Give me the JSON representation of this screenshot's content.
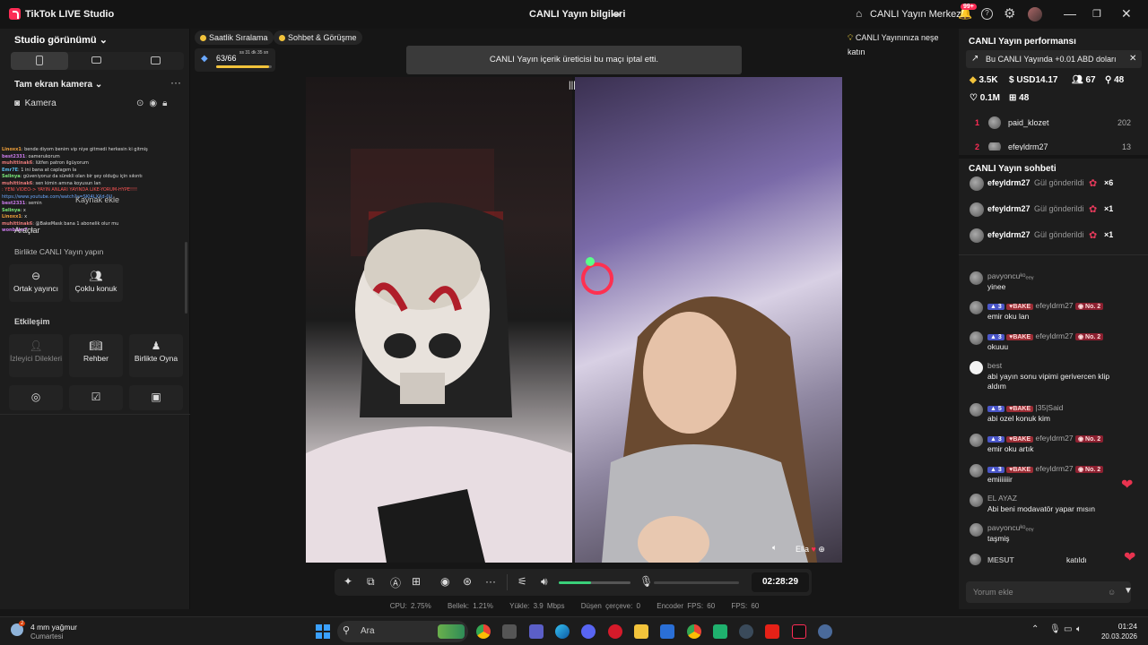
{
  "titlebar": {
    "app_name": "TikTok LIVE Studio",
    "center_title": "CANLI Yayın bilgileri",
    "home_label": "CANLI Yayın Merkezi",
    "notif_badge": "99+"
  },
  "left": {
    "studio_view": "Studio görünümü",
    "camera_section": "Tam ekran kamera",
    "camera_source": "Kamera",
    "ghost_add_source": "Kaynak ekle",
    "ghost_tools": "Araçlar",
    "ghost_together": "Birlikte CANLI Yayın yapın",
    "cohost_cards": [
      {
        "label": "Ortak yayıncı",
        "icon": "link-icon"
      },
      {
        "label": "Çoklu konuk",
        "icon": "users-icon"
      }
    ],
    "interaction_title": "Etkileşim",
    "interaction_cards": [
      {
        "label": "İzleyici Dilekleri",
        "icon": "user-wish-icon"
      },
      {
        "label": "Rehber",
        "icon": "guide-icon"
      },
      {
        "label": "Birlikte Oyna",
        "icon": "play-together-icon"
      }
    ],
    "chat_overlay": [
      {
        "u": "Linoxx1",
        "t": ": bende diyom benim vip niye gitmedi herkesin ki gitmiş",
        "c": "#f0a03a"
      },
      {
        "u": "best2331",
        "t": ": oamerukorum",
        "c": "#c87ae8"
      },
      {
        "u": "muhittinak6",
        "t": ": lütfen patron ilgüyorum",
        "c": "#e87a7a"
      },
      {
        "u": "Emr7E",
        "t": ": 1 ini bana at caplagım la",
        "c": "#58b8e8"
      },
      {
        "u": "Selinya",
        "t": ": güveniyoruz da sürekli olan bir şey olduğu için sıkıntı",
        "c": "#7ae87a"
      },
      {
        "u": "muhittinak6",
        "t": ": sen kimin amına koyusun lan",
        "c": "#e87a7a"
      },
      {
        "u": "",
        "t": ": YENİ VİDEO-> YAYIN ANLARI YAYINDA LIKE-YORUM-HYPE!!!!",
        "c": "#ff5555"
      },
      {
        "u": "",
        "t": "https://www.youtube.com/watch?v=SKI4LXXd-0U",
        "c": "#6aa8ff"
      },
      {
        "u": "best2331",
        "t": ": semin",
        "c": "#c87ae8"
      },
      {
        "u": "Selinya",
        "t": ": x",
        "c": "#7ae87a"
      },
      {
        "u": "Linoxx1",
        "t": ": x",
        "c": "#f0a03a"
      },
      {
        "u": "muhittinak6",
        "t": ": @BakeMask bana 1 abonelik olur mu",
        "c": "#e87a7a"
      },
      {
        "u": "wonbaka7",
        "t": ": x",
        "c": "#c87ae8"
      }
    ]
  },
  "stage": {
    "pills": [
      "Saatlik Sıralama",
      "Sohbet & Görüşme"
    ],
    "right_pill": "CANLI Yayınınıza neşe katın",
    "rank_value": "63/66",
    "rank_sub": "ss 31 dk 35 sn",
    "toast": "CANLI Yayın içerik üreticisi bu maçı iptal etti.",
    "guest_name": "Ella",
    "timer": "02:28:29",
    "volume": 0.45,
    "stats": [
      "CPU: 2.75%",
      "Bellek: 1.21%",
      "Yükle: 3.9 Mbps",
      "Düşen çerçeve: 0",
      "Encoder FPS: 60",
      "FPS: 60"
    ]
  },
  "right": {
    "perf_title": "CANLI Yayın performansı",
    "banner": "Bu CANLI Yayında +0.01 ABD doları",
    "stats": {
      "diamonds": "3.5K",
      "usd": "USD14.17",
      "viewers": "67",
      "followers": "48",
      "likes": "0.1M",
      "gifts": "48"
    },
    "ranking": [
      {
        "n": "1",
        "name": "paid_klozet",
        "v": "202"
      },
      {
        "n": "2",
        "name": "efeyldrm27",
        "v": "13"
      }
    ],
    "chat_title": "CANLI Yayın sohbeti",
    "gifts": [
      {
        "user": "efeyldrm27",
        "action": "Gül gönderildi",
        "count": "×6"
      },
      {
        "user": "efeyldrm27",
        "action": "Gül gönderildi",
        "count": "×1"
      },
      {
        "user": "efeyldrm27",
        "action": "Gül gönderildi",
        "count": "×1"
      }
    ],
    "messages": [
      {
        "user": "pavyoncuᵏᵒₑₑᵧ",
        "text": "yinee",
        "badges": false
      },
      {
        "user": "efeyldrm27",
        "text": "emir oku lan",
        "badges": true,
        "lv": "3"
      },
      {
        "user": "efeyldrm27",
        "text": "okuuu",
        "badges": true,
        "lv": "3"
      },
      {
        "user": "best",
        "text": "abi yayın sonu vipimi gerivercen klip aldım",
        "badges": false
      },
      {
        "user": "|35|Said",
        "text": "abi ozel konuk kim",
        "badges": true,
        "lv": "5",
        "nono": true
      },
      {
        "user": "efeyldrm27",
        "text": "emir oku artık",
        "badges": true,
        "lv": "3"
      },
      {
        "user": "efeyldrm27",
        "text": "emiiiiiiir",
        "badges": true,
        "lv": "3"
      },
      {
        "user": "EL AYAZ",
        "text": "Abi beni modavatör yapar mısın",
        "badges": false
      },
      {
        "user": "pavyoncuᵏᵒₑₑᵧ",
        "text": "taşmiş",
        "badges": false
      }
    ],
    "join_user": "MESUT",
    "join_text": "katıldı",
    "bake": "BAKE",
    "no2": "No. 2",
    "comment_placeholder": "Yorum ekle"
  },
  "taskbar": {
    "weather": "4 mm yağmur",
    "weather_day": "Cumartesi",
    "weather_badge": "2",
    "search": "Ara",
    "time": "01:24",
    "date": "20.03.2026",
    "apps": [
      "chrome",
      "store",
      "teams",
      "edge",
      "discord",
      "opera",
      "explorer",
      "mail",
      "chrome-2",
      "app-green",
      "steam",
      "youtube",
      "tiktok",
      "settings"
    ]
  }
}
